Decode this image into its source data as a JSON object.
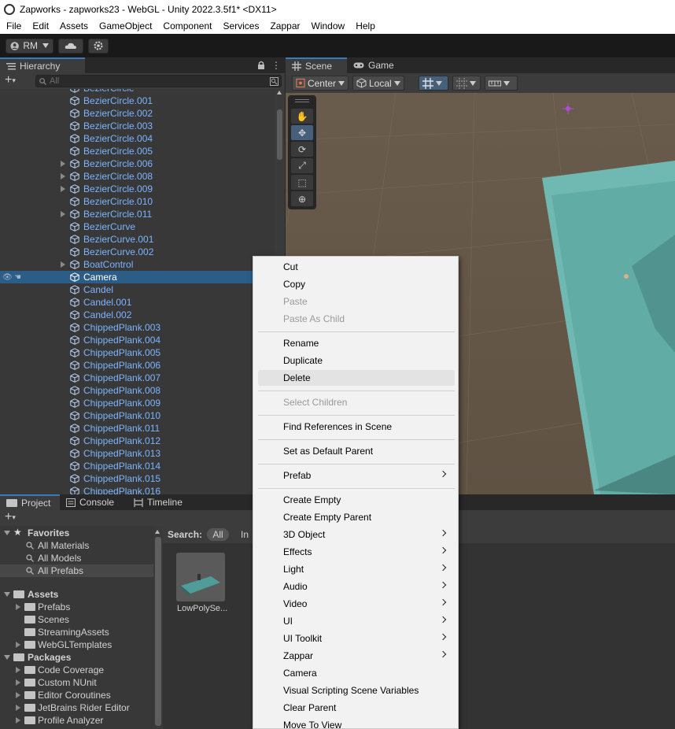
{
  "title": "Zapworks - zapworks23 - WebGL - Unity 2022.3.5f1* <DX11>",
  "menu": [
    "File",
    "Edit",
    "Assets",
    "GameObject",
    "Component",
    "Services",
    "Zappar",
    "Window",
    "Help"
  ],
  "toolbar": {
    "account": "RM"
  },
  "hierarchy": {
    "tab": "Hierarchy",
    "search_placeholder": "All",
    "selected": "Camera",
    "items": [
      {
        "label": "BezierCircle",
        "arrow": false
      },
      {
        "label": "BezierCircle.001",
        "arrow": false
      },
      {
        "label": "BezierCircle.002",
        "arrow": false
      },
      {
        "label": "BezierCircle.003",
        "arrow": false
      },
      {
        "label": "BezierCircle.004",
        "arrow": false
      },
      {
        "label": "BezierCircle.005",
        "arrow": false
      },
      {
        "label": "BezierCircle.006",
        "arrow": true
      },
      {
        "label": "BezierCircle.008",
        "arrow": true
      },
      {
        "label": "BezierCircle.009",
        "arrow": true
      },
      {
        "label": "BezierCircle.010",
        "arrow": false
      },
      {
        "label": "BezierCircle.011",
        "arrow": true
      },
      {
        "label": "BezierCurve",
        "arrow": false
      },
      {
        "label": "BezierCurve.001",
        "arrow": false
      },
      {
        "label": "BezierCurve.002",
        "arrow": false
      },
      {
        "label": "BoatControl",
        "arrow": true
      },
      {
        "label": "Camera",
        "arrow": false
      },
      {
        "label": "Candel",
        "arrow": false
      },
      {
        "label": "Candel.001",
        "arrow": false
      },
      {
        "label": "Candel.002",
        "arrow": false
      },
      {
        "label": "ChippedPlank.003",
        "arrow": false
      },
      {
        "label": "ChippedPlank.004",
        "arrow": false
      },
      {
        "label": "ChippedPlank.005",
        "arrow": false
      },
      {
        "label": "ChippedPlank.006",
        "arrow": false
      },
      {
        "label": "ChippedPlank.007",
        "arrow": false
      },
      {
        "label": "ChippedPlank.008",
        "arrow": false
      },
      {
        "label": "ChippedPlank.009",
        "arrow": false
      },
      {
        "label": "ChippedPlank.010",
        "arrow": false
      },
      {
        "label": "ChippedPlank.011",
        "arrow": false
      },
      {
        "label": "ChippedPlank.012",
        "arrow": false
      },
      {
        "label": "ChippedPlank.013",
        "arrow": false
      },
      {
        "label": "ChippedPlank.014",
        "arrow": false
      },
      {
        "label": "ChippedPlank.015",
        "arrow": false
      },
      {
        "label": "ChippedPlank.016",
        "arrow": false
      }
    ]
  },
  "scene": {
    "tabs": [
      "Scene",
      "Game"
    ],
    "pivot": "Center",
    "space": "Local"
  },
  "bottom": {
    "tabs": [
      "Project",
      "Console",
      "Timeline"
    ],
    "search_label": "Search:",
    "scope_all": "All",
    "scope_in": "In",
    "asset": "LowPolySe...",
    "tree": [
      {
        "label": "Favorites",
        "type": "fav-header"
      },
      {
        "label": "All Materials",
        "type": "search"
      },
      {
        "label": "All Models",
        "type": "search"
      },
      {
        "label": "All Prefabs",
        "type": "search",
        "selected": true
      },
      {
        "label": "",
        "type": "spacer"
      },
      {
        "label": "Assets",
        "type": "header"
      },
      {
        "label": "Prefabs",
        "type": "folder",
        "arrow": true
      },
      {
        "label": "Scenes",
        "type": "folder",
        "arrow": false
      },
      {
        "label": "StreamingAssets",
        "type": "folder",
        "arrow": false
      },
      {
        "label": "WebGLTemplates",
        "type": "folder",
        "arrow": true
      },
      {
        "label": "Packages",
        "type": "header"
      },
      {
        "label": "Code Coverage",
        "type": "folder",
        "arrow": true
      },
      {
        "label": "Custom NUnit",
        "type": "folder",
        "arrow": true
      },
      {
        "label": "Editor Coroutines",
        "type": "folder",
        "arrow": true
      },
      {
        "label": "JetBrains Rider Editor",
        "type": "folder",
        "arrow": true
      },
      {
        "label": "Profile Analyzer",
        "type": "folder",
        "arrow": true
      }
    ]
  },
  "context_menu": {
    "groups": [
      [
        {
          "label": "Cut"
        },
        {
          "label": "Copy"
        },
        {
          "label": "Paste",
          "disabled": true
        },
        {
          "label": "Paste As Child",
          "disabled": true
        }
      ],
      [
        {
          "label": "Rename"
        },
        {
          "label": "Duplicate"
        },
        {
          "label": "Delete",
          "hover": true
        }
      ],
      [
        {
          "label": "Select Children",
          "disabled": true
        }
      ],
      [
        {
          "label": "Find References in Scene"
        }
      ],
      [
        {
          "label": "Set as Default Parent"
        }
      ],
      [
        {
          "label": "Prefab",
          "submenu": true
        }
      ],
      [
        {
          "label": "Create Empty"
        },
        {
          "label": "Create Empty Parent"
        },
        {
          "label": "3D Object",
          "submenu": true
        },
        {
          "label": "Effects",
          "submenu": true
        },
        {
          "label": "Light",
          "submenu": true
        },
        {
          "label": "Audio",
          "submenu": true
        },
        {
          "label": "Video",
          "submenu": true
        },
        {
          "label": "UI",
          "submenu": true
        },
        {
          "label": "UI Toolkit",
          "submenu": true
        },
        {
          "label": "Zappar",
          "submenu": true
        },
        {
          "label": "Camera"
        },
        {
          "label": "Visual Scripting Scene Variables"
        },
        {
          "label": "Clear Parent"
        },
        {
          "label": "Move To View"
        }
      ]
    ]
  }
}
